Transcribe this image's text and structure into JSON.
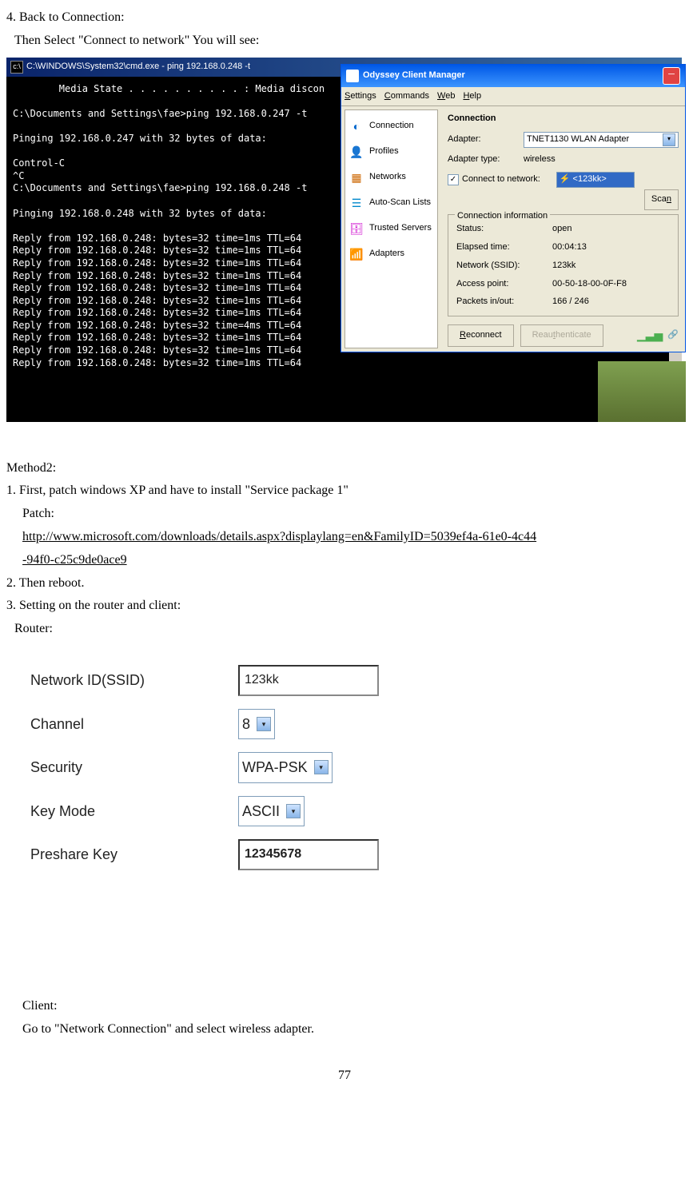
{
  "step4": "4. Back to Connection:",
  "step4_sub": "Then Select \"Connect to network\" You will see:",
  "cmd": {
    "title": "C:\\WINDOWS\\System32\\cmd.exe - ping 192.168.0.248 -t",
    "lines": "        Media State . . . . . . . . . . : Media discon\n\nC:\\Documents and Settings\\fae>ping 192.168.0.247 -t\n\nPinging 192.168.0.247 with 32 bytes of data:\n\nControl-C\n^C\nC:\\Documents and Settings\\fae>ping 192.168.0.248 -t\n\nPinging 192.168.0.248 with 32 bytes of data:\n\nReply from 192.168.0.248: bytes=32 time=1ms TTL=64\nReply from 192.168.0.248: bytes=32 time=1ms TTL=64\nReply from 192.168.0.248: bytes=32 time=1ms TTL=64\nReply from 192.168.0.248: bytes=32 time=1ms TTL=64\nReply from 192.168.0.248: bytes=32 time=1ms TTL=64\nReply from 192.168.0.248: bytes=32 time=1ms TTL=64\nReply from 192.168.0.248: bytes=32 time=1ms TTL=64\nReply from 192.168.0.248: bytes=32 time=4ms TTL=64\nReply from 192.168.0.248: bytes=32 time=1ms TTL=64\nReply from 192.168.0.248: bytes=32 time=1ms TTL=64\nReply from 192.168.0.248: bytes=32 time=1ms TTL=64"
  },
  "odyssey": {
    "title": "Odyssey Client Manager",
    "menu": {
      "settings": "Settings",
      "commands": "Commands",
      "web": "Web",
      "help": "Help"
    },
    "sidebar": {
      "connection": "Connection",
      "profiles": "Profiles",
      "networks": "Networks",
      "autoscan": "Auto-Scan Lists",
      "trusted": "Trusted Servers",
      "adapters": "Adapters"
    },
    "main": {
      "header": "Connection",
      "adapter_label": "Adapter:",
      "adapter_value": "TNET1130 WLAN Adapter",
      "adapter_type_label": "Adapter type:",
      "adapter_type_value": "wireless",
      "connect_label": "Connect to network:",
      "network_value": "<123kk>",
      "scan": "Scan",
      "info_legend": "Connection information",
      "status_label": "Status:",
      "status_value": "open",
      "elapsed_label": "Elapsed time:",
      "elapsed_value": "00:04:13",
      "ssid_label": "Network (SSID):",
      "ssid_value": "123kk",
      "ap_label": "Access point:",
      "ap_value": "00-50-18-00-0F-F8",
      "packets_label": "Packets in/out:",
      "packets_value": "166 / 246",
      "reconnect": "Reconnect",
      "reauth": "Reauthenticate"
    }
  },
  "method2": "Method2:",
  "method2_step1": "1. First, patch windows XP and have to install \"Service package 1\"",
  "patch_label": "Patch:",
  "patch_link1": "http://www.microsoft.com/downloads/details.aspx?displaylang=en&FamilyID=5039ef4a-61e0-4c44",
  "patch_link2": "-94f0-c25c9de0ace9",
  "method2_step2": "2. Then reboot.",
  "method2_step3": "3. Setting on the router and client:",
  "router_label": "Router:",
  "router": {
    "ssid_label": "Network ID(SSID)",
    "ssid_value": "123kk",
    "channel_label": "Channel",
    "channel_value": "8",
    "security_label": "Security",
    "security_value": "WPA-PSK",
    "keymode_label": "Key Mode",
    "keymode_value": "ASCII",
    "presharekey_label": "Preshare Key",
    "presharekey_value": "12345678"
  },
  "client_label": "Client:",
  "client_text": "Go to \"Network Connection\" and select wireless adapter.",
  "page_num": "77"
}
